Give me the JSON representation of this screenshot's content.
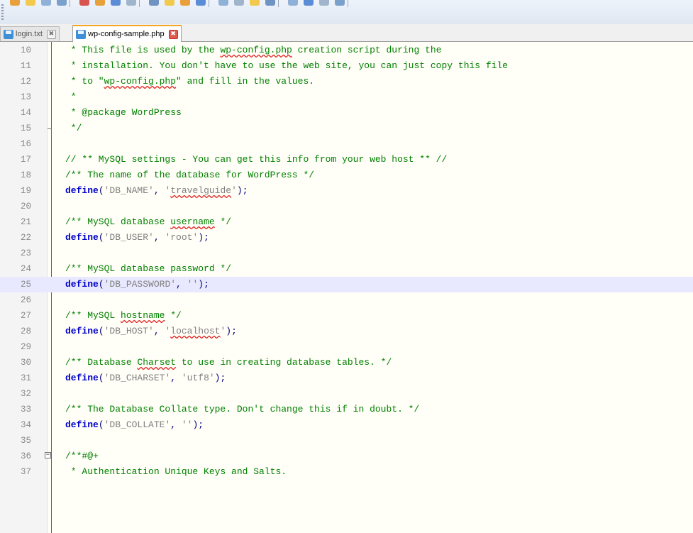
{
  "colors": {
    "comment": "#008000",
    "keyword": "#0000cc",
    "string": "#808080",
    "current_line": "#e8e8ff",
    "fold_line": "#d32f2f"
  },
  "tabs": [
    {
      "label": "login.txt",
      "icon": "save-icon",
      "active": false
    },
    {
      "label": "wp-config-sample.php",
      "icon": "save-icon",
      "active": true
    }
  ],
  "close_glyph": "✖",
  "editor": {
    "current_line": 25,
    "lines": [
      {
        "n": "10",
        "segs": [
          {
            "t": " * This file is used by the ",
            "c": "comment"
          },
          {
            "t": "wp-config.php",
            "c": "comment",
            "sq": true
          },
          {
            "t": " creation script during the",
            "c": "comment"
          }
        ]
      },
      {
        "n": "11",
        "segs": [
          {
            "t": " * installation. You don't have to use the web site, you can just copy this file",
            "c": "comment"
          }
        ]
      },
      {
        "n": "12",
        "segs": [
          {
            "t": " * to \"",
            "c": "comment"
          },
          {
            "t": "wp-config.php",
            "c": "comment",
            "sq": true
          },
          {
            "t": "\" and fill in the values.",
            "c": "comment"
          }
        ]
      },
      {
        "n": "13",
        "segs": [
          {
            "t": " *",
            "c": "comment"
          }
        ]
      },
      {
        "n": "14",
        "segs": [
          {
            "t": " * @package WordPress",
            "c": "comment"
          }
        ]
      },
      {
        "n": "15",
        "segs": [
          {
            "t": " */",
            "c": "comment"
          }
        ],
        "fold_end": true
      },
      {
        "n": "16",
        "segs": []
      },
      {
        "n": "17",
        "segs": [
          {
            "t": "// ** MySQL settings - You can get this info from your web host ** //",
            "c": "comment"
          }
        ]
      },
      {
        "n": "18",
        "segs": [
          {
            "t": "/** The name of the database for WordPress */",
            "c": "comment"
          }
        ]
      },
      {
        "n": "19",
        "segs": [
          {
            "t": "define",
            "c": "kw"
          },
          {
            "t": "(",
            "c": "punct"
          },
          {
            "t": "'DB_NAME'",
            "c": "str"
          },
          {
            "t": ", ",
            "c": "punct"
          },
          {
            "t": "'",
            "c": "str"
          },
          {
            "t": "travelguide",
            "c": "str",
            "sq": true
          },
          {
            "t": "'",
            "c": "str"
          },
          {
            "t": ");",
            "c": "punct"
          }
        ]
      },
      {
        "n": "20",
        "segs": []
      },
      {
        "n": "21",
        "segs": [
          {
            "t": "/** MySQL database ",
            "c": "comment"
          },
          {
            "t": "username",
            "c": "comment",
            "sq": true
          },
          {
            "t": " */",
            "c": "comment"
          }
        ]
      },
      {
        "n": "22",
        "segs": [
          {
            "t": "define",
            "c": "kw"
          },
          {
            "t": "(",
            "c": "punct"
          },
          {
            "t": "'DB_USER'",
            "c": "str"
          },
          {
            "t": ", ",
            "c": "punct"
          },
          {
            "t": "'root'",
            "c": "str"
          },
          {
            "t": ");",
            "c": "punct"
          }
        ]
      },
      {
        "n": "23",
        "segs": []
      },
      {
        "n": "24",
        "segs": [
          {
            "t": "/** MySQL database password */",
            "c": "comment"
          }
        ]
      },
      {
        "n": "25",
        "segs": [
          {
            "t": "define",
            "c": "kw"
          },
          {
            "t": "(",
            "c": "punct"
          },
          {
            "t": "'DB_PASSWORD'",
            "c": "str"
          },
          {
            "t": ", ",
            "c": "punct"
          },
          {
            "t": "''",
            "c": "str"
          },
          {
            "t": ");",
            "c": "punct"
          }
        ]
      },
      {
        "n": "26",
        "segs": []
      },
      {
        "n": "27",
        "segs": [
          {
            "t": "/** MySQL ",
            "c": "comment"
          },
          {
            "t": "hostname",
            "c": "comment",
            "sq": true
          },
          {
            "t": " */",
            "c": "comment"
          }
        ]
      },
      {
        "n": "28",
        "segs": [
          {
            "t": "define",
            "c": "kw"
          },
          {
            "t": "(",
            "c": "punct"
          },
          {
            "t": "'DB_HOST'",
            "c": "str"
          },
          {
            "t": ", ",
            "c": "punct"
          },
          {
            "t": "'",
            "c": "str"
          },
          {
            "t": "localhost",
            "c": "str",
            "sq": true
          },
          {
            "t": "'",
            "c": "str"
          },
          {
            "t": ");",
            "c": "punct"
          }
        ]
      },
      {
        "n": "29",
        "segs": []
      },
      {
        "n": "30",
        "segs": [
          {
            "t": "/** Database ",
            "c": "comment"
          },
          {
            "t": "Charset",
            "c": "comment",
            "sq": true
          },
          {
            "t": " to use in creating database tables. */",
            "c": "comment"
          }
        ]
      },
      {
        "n": "31",
        "segs": [
          {
            "t": "define",
            "c": "kw"
          },
          {
            "t": "(",
            "c": "punct"
          },
          {
            "t": "'DB_CHARSET'",
            "c": "str"
          },
          {
            "t": ", ",
            "c": "punct"
          },
          {
            "t": "'utf8'",
            "c": "str"
          },
          {
            "t": ");",
            "c": "punct"
          }
        ]
      },
      {
        "n": "32",
        "segs": []
      },
      {
        "n": "33",
        "segs": [
          {
            "t": "/** The Database Collate type. Don't change this if in doubt. */",
            "c": "comment"
          }
        ]
      },
      {
        "n": "34",
        "segs": [
          {
            "t": "define",
            "c": "kw"
          },
          {
            "t": "(",
            "c": "punct"
          },
          {
            "t": "'DB_COLLATE'",
            "c": "str"
          },
          {
            "t": ", ",
            "c": "punct"
          },
          {
            "t": "''",
            "c": "str"
          },
          {
            "t": ");",
            "c": "punct"
          }
        ]
      },
      {
        "n": "35",
        "segs": []
      },
      {
        "n": "36",
        "segs": [
          {
            "t": "/**#@+",
            "c": "comment"
          }
        ],
        "fold_start": true
      },
      {
        "n": "37",
        "segs": [
          {
            "t": " * Authentication Unique Keys and Salts.",
            "c": "comment"
          }
        ]
      }
    ]
  }
}
